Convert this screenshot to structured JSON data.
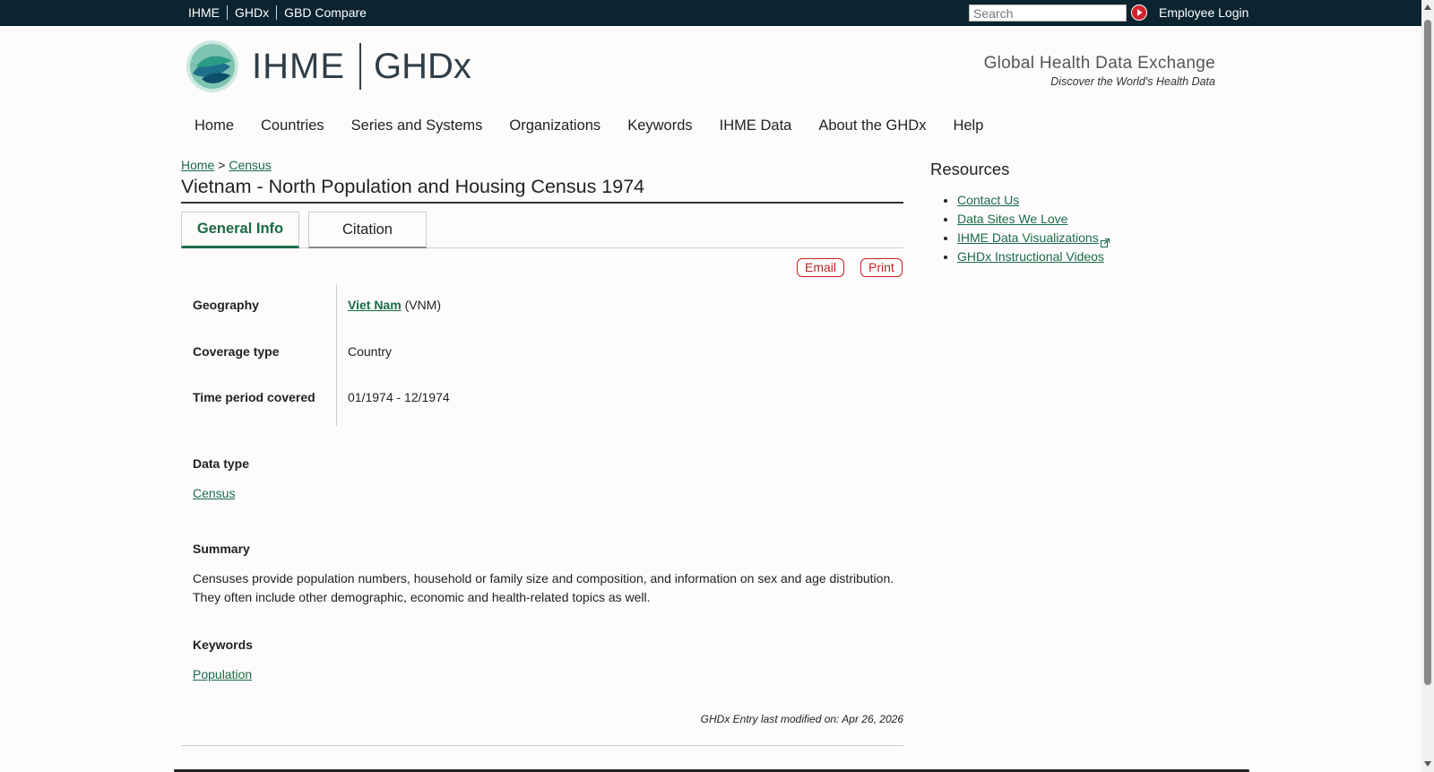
{
  "topbar": {
    "links": [
      "IHME",
      "GHDx",
      "GBD Compare"
    ],
    "search_placeholder": "Search",
    "employee_login": "Employee Login"
  },
  "header": {
    "logo_ihme": "IHME",
    "logo_ghdx": "GHDx",
    "tagline": "Global Health Data Exchange",
    "subtagline": "Discover the World's Health Data"
  },
  "nav": [
    "Home",
    "Countries",
    "Series and Systems",
    "Organizations",
    "Keywords",
    "IHME Data",
    "About the GHDx",
    "Help"
  ],
  "breadcrumb": {
    "home": "Home",
    "sep": ">",
    "current": "Census"
  },
  "page_title": "Vietnam - North Population and Housing Census 1974",
  "tabs": [
    "General Info",
    "Citation"
  ],
  "actions": {
    "email": "Email",
    "print": "Print"
  },
  "fields": {
    "geography_label": "Geography",
    "geography_link": "Viet Nam",
    "geography_code": "(VNM)",
    "coverage_label": "Coverage type",
    "coverage_value": "Country",
    "time_label": "Time period covered",
    "time_value": "01/1974 - 12/1974"
  },
  "data_type": {
    "label": "Data type",
    "value": "Census"
  },
  "summary": {
    "label": "Summary",
    "line1": "Censuses provide population numbers, household or family size and composition, and information on sex and age distribution.",
    "line2": "They often include other demographic, economic and health-related topics as well."
  },
  "keywords": {
    "label": "Keywords",
    "value": "Population"
  },
  "modified": "GHDx Entry last modified on: Apr 26, 2026",
  "sidebar": {
    "title": "Resources",
    "items": [
      "Contact Us",
      "Data Sites We Love",
      "IHME Data Visualizations",
      "GHDx Instructional Videos"
    ]
  },
  "colors": {
    "link": "#1a6b4a",
    "topbar": "#0b2430",
    "action": "#c32020"
  }
}
